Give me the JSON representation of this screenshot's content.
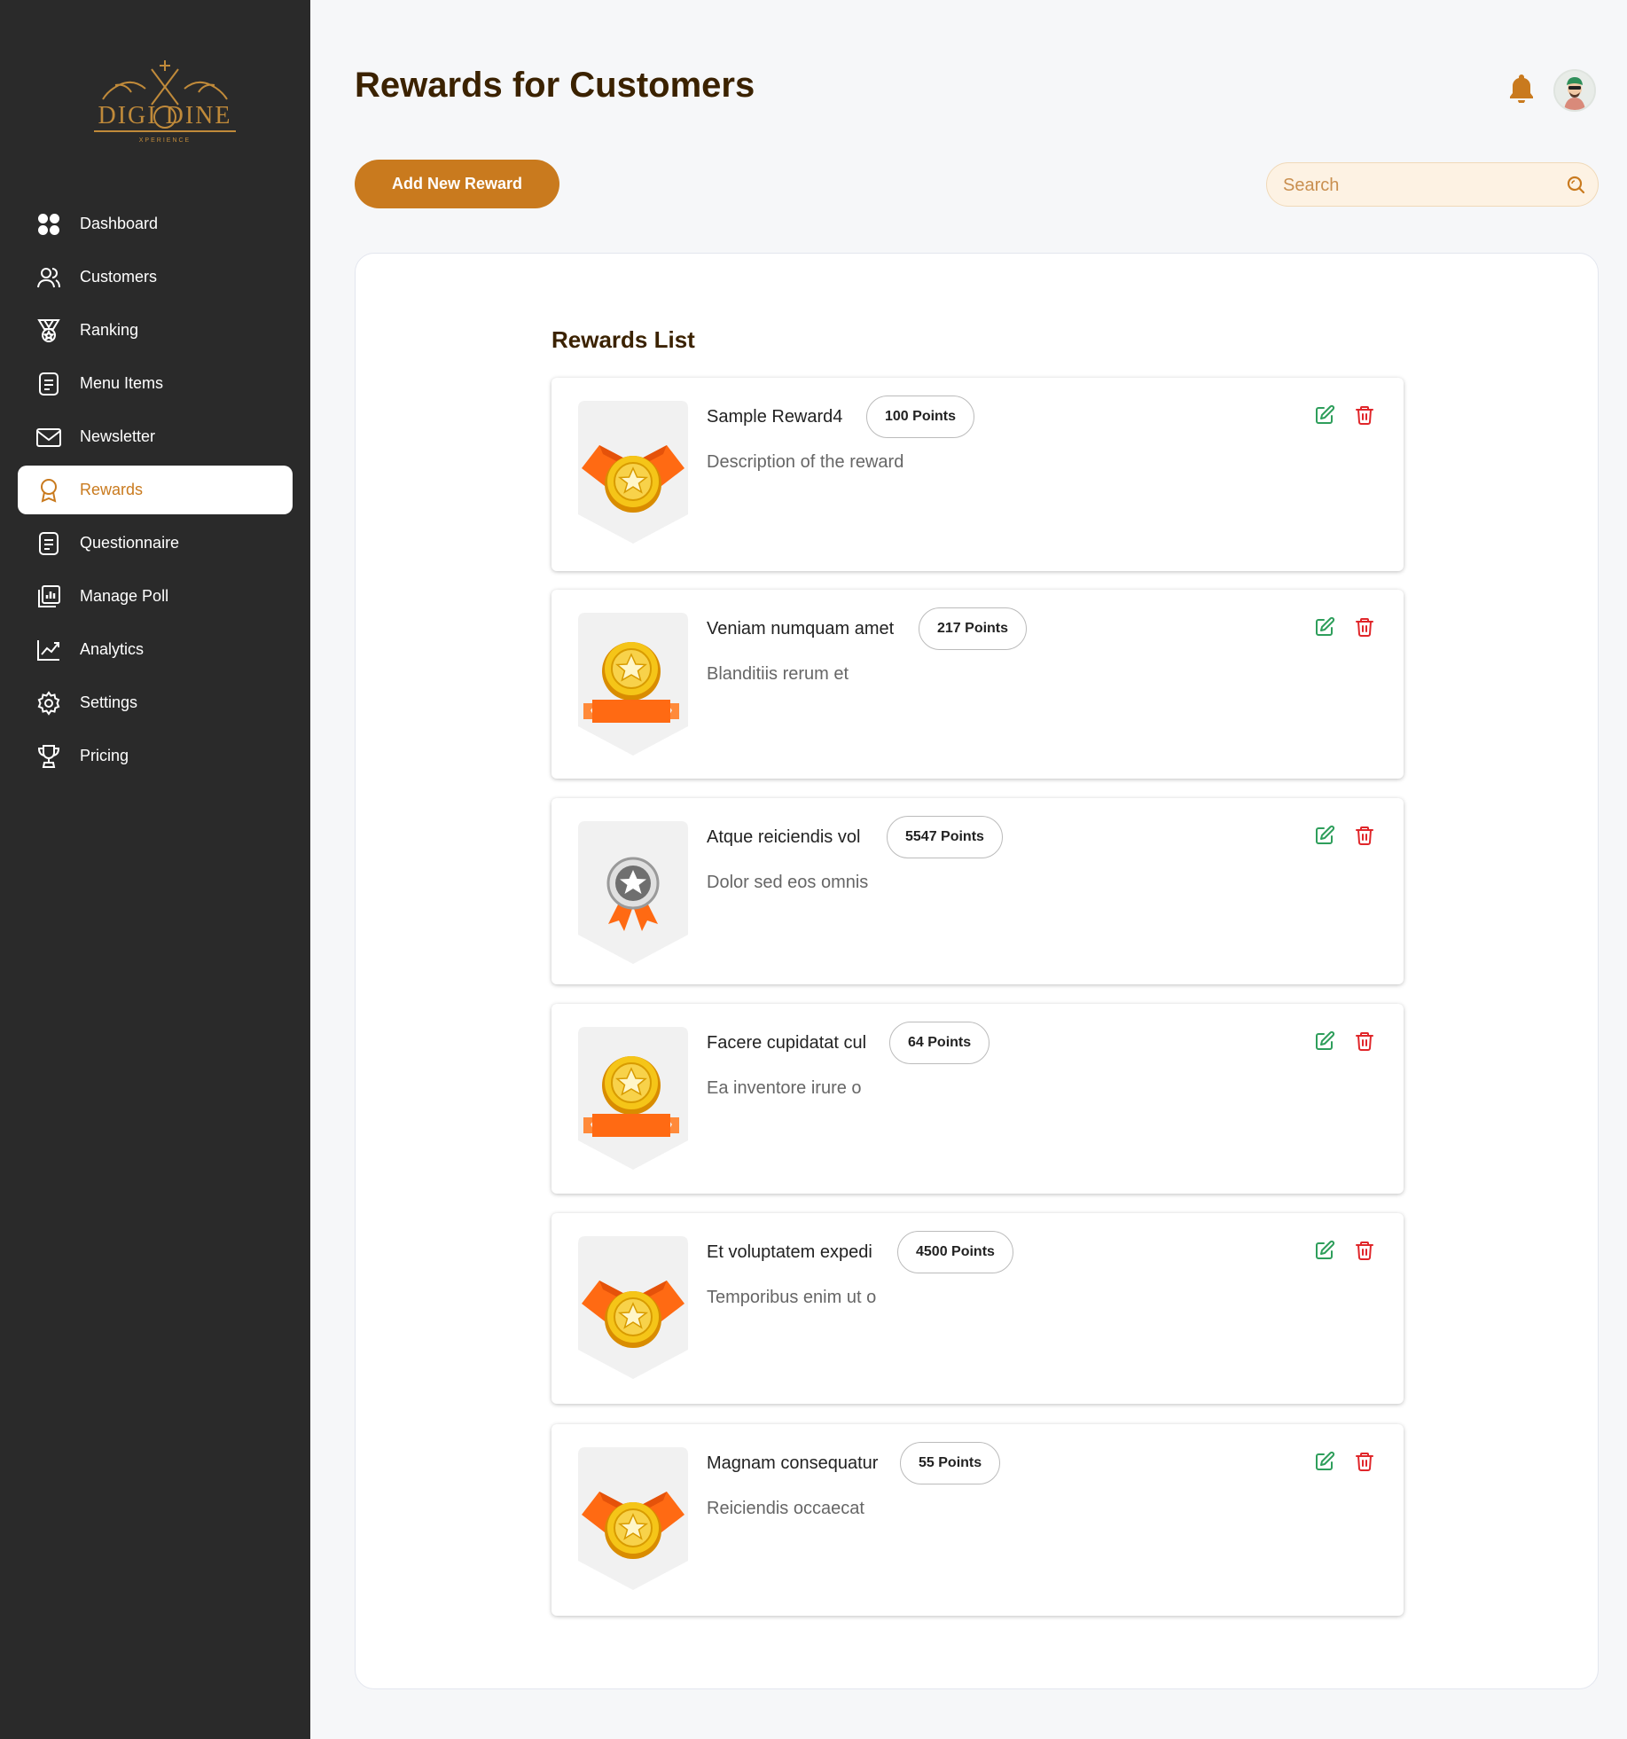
{
  "brand": {
    "logo_text": "DIGI DINE",
    "logo_subtext": "XPERIENCE"
  },
  "sidebar": {
    "items": [
      {
        "label": "Dashboard",
        "icon": "dashboard-grid-icon",
        "active": false
      },
      {
        "label": "Customers",
        "icon": "users-icon",
        "active": false
      },
      {
        "label": "Ranking",
        "icon": "medal-icon",
        "active": false
      },
      {
        "label": "Menu Items",
        "icon": "menu-document-icon",
        "active": false
      },
      {
        "label": "Newsletter",
        "icon": "mail-icon",
        "active": false
      },
      {
        "label": "Rewards",
        "icon": "reward-ribbon-icon",
        "active": true
      },
      {
        "label": "Questionnaire",
        "icon": "questionnaire-document-icon",
        "active": false
      },
      {
        "label": "Manage Poll",
        "icon": "poll-chart-icon",
        "active": false
      },
      {
        "label": "Analytics",
        "icon": "analytics-line-icon",
        "active": false
      },
      {
        "label": "Settings",
        "icon": "gear-icon",
        "active": false
      },
      {
        "label": "Pricing",
        "icon": "trophy-icon",
        "active": false
      }
    ]
  },
  "header": {
    "title": "Rewards for Customers"
  },
  "toolbar": {
    "add_label": "Add New Reward"
  },
  "search": {
    "placeholder": "Search",
    "value": ""
  },
  "rewards": {
    "title": "Rewards List",
    "items": [
      {
        "name": "Sample Reward4",
        "points": "100 Points",
        "description": "Description of the reward",
        "badge": "medal-ribbon"
      },
      {
        "name": "Veniam numquam amet",
        "points": "217 Points",
        "description": "Blanditiis rerum et",
        "badge": "medal-banner"
      },
      {
        "name": "Atque reiciendis vol",
        "points": "5547 Points",
        "description": "Dolor sed eos omnis",
        "badge": "silver-medal"
      },
      {
        "name": "Facere cupidatat cul",
        "points": "64 Points",
        "description": "Ea inventore irure o",
        "badge": "medal-banner"
      },
      {
        "name": "Et voluptatem expedi",
        "points": "4500 Points",
        "description": "Temporibus enim ut o",
        "badge": "medal-ribbon"
      },
      {
        "name": "Magnam consequatur",
        "points": "55 Points",
        "description": "Reiciendis occaecat",
        "badge": "medal-ribbon"
      }
    ]
  },
  "colors": {
    "accent": "#c97a1e",
    "sidebar_bg": "#2a2a2a",
    "heading": "#3b2200",
    "edit_icon": "#2e9e5b",
    "delete_icon": "#e0262a",
    "badge_orange": "#ff6a13",
    "badge_gold": "#f5c518"
  }
}
